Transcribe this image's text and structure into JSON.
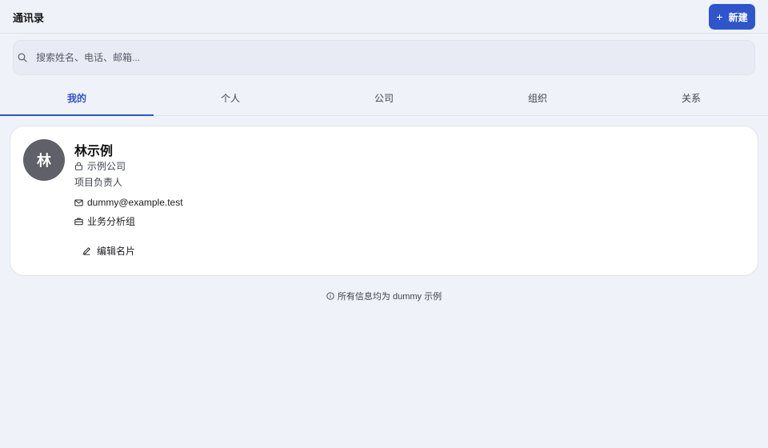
{
  "header": {
    "title": "通讯录",
    "new_button": {
      "icon": "plus-icon",
      "label": "新建"
    },
    "accent_color": "#2e55cc"
  },
  "search": {
    "icon": "search-icon",
    "value": "",
    "placeholder": "搜索姓名、电话、邮箱..."
  },
  "tabs": [
    {
      "label": "我的",
      "active": true
    },
    {
      "label": "个人",
      "active": false
    },
    {
      "label": "公司",
      "active": false
    },
    {
      "label": "组织",
      "active": false
    },
    {
      "label": "关系",
      "active": false
    }
  ],
  "contact": {
    "avatar_text": "林",
    "avatar_color": "#5f6068",
    "name": "林示例",
    "company": {
      "icon": "lock-icon",
      "text": "示例公司"
    },
    "role": "项目负责人",
    "email": {
      "icon": "mail-icon",
      "text": "dummy@example.test"
    },
    "group": {
      "icon": "briefcase-icon",
      "text": "业务分析组"
    },
    "edit_button": {
      "icon": "pencil-icon",
      "label": "编辑名片"
    }
  },
  "footer": {
    "icon": "info-icon",
    "text": "所有信息均为 dummy 示例"
  }
}
